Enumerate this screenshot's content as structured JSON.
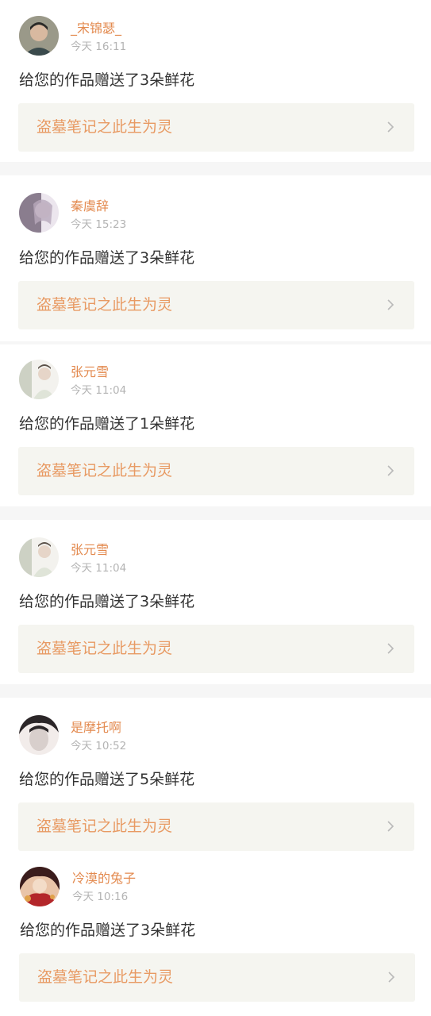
{
  "notifications": [
    {
      "user": "_宋锦瑟_",
      "time": "今天 16:11",
      "message": "给您的作品赠送了3朵鲜花",
      "work": "盗墓笔记之此生为灵",
      "avatar_colors": [
        "#3a4a4c",
        "#7b7f70",
        "#c9c0b0"
      ]
    },
    {
      "user": "秦虞辞",
      "time": "今天 15:23",
      "message": "给您的作品赠送了3朵鲜花",
      "work": "盗墓笔记之此生为灵",
      "avatar_colors": [
        "#6a5a6e",
        "#b8a9bc",
        "#ece6ee"
      ]
    },
    {
      "user": "张元雪",
      "time": "今天 11:04",
      "message": "给您的作品赠送了1朵鲜花",
      "work": "盗墓笔记之此生为灵",
      "avatar_colors": [
        "#dfe4d8",
        "#bcc3b2",
        "#f3f2ee"
      ]
    },
    {
      "user": "张元雪",
      "time": "今天 11:04",
      "message": "给您的作品赠送了3朵鲜花",
      "work": "盗墓笔记之此生为灵",
      "avatar_colors": [
        "#dfe4d8",
        "#bcc3b2",
        "#f3f2ee"
      ]
    },
    {
      "user": "是摩托啊",
      "time": "今天 10:52",
      "message": "给您的作品赠送了5朵鲜花",
      "work": "盗墓笔记之此生为灵",
      "avatar_colors": [
        "#2b2628",
        "#d8cfcc",
        "#f2ecea"
      ]
    },
    {
      "user": "冷漠的兔子",
      "time": "今天 10:16",
      "message": "给您的作品赠送了3朵鲜花",
      "work": "盗墓笔记之此生为灵",
      "avatar_colors": [
        "#b3262a",
        "#e9c4a8",
        "#3a1c1c"
      ]
    }
  ],
  "colors": {
    "username": "#e38a4f",
    "work_title": "#e89a63",
    "time": "#b4b4b4",
    "message": "#333333",
    "work_bg": "#f5f5f0",
    "separator": "#f6f6f6"
  },
  "icons": {
    "chevron": "chevron-right-icon"
  }
}
